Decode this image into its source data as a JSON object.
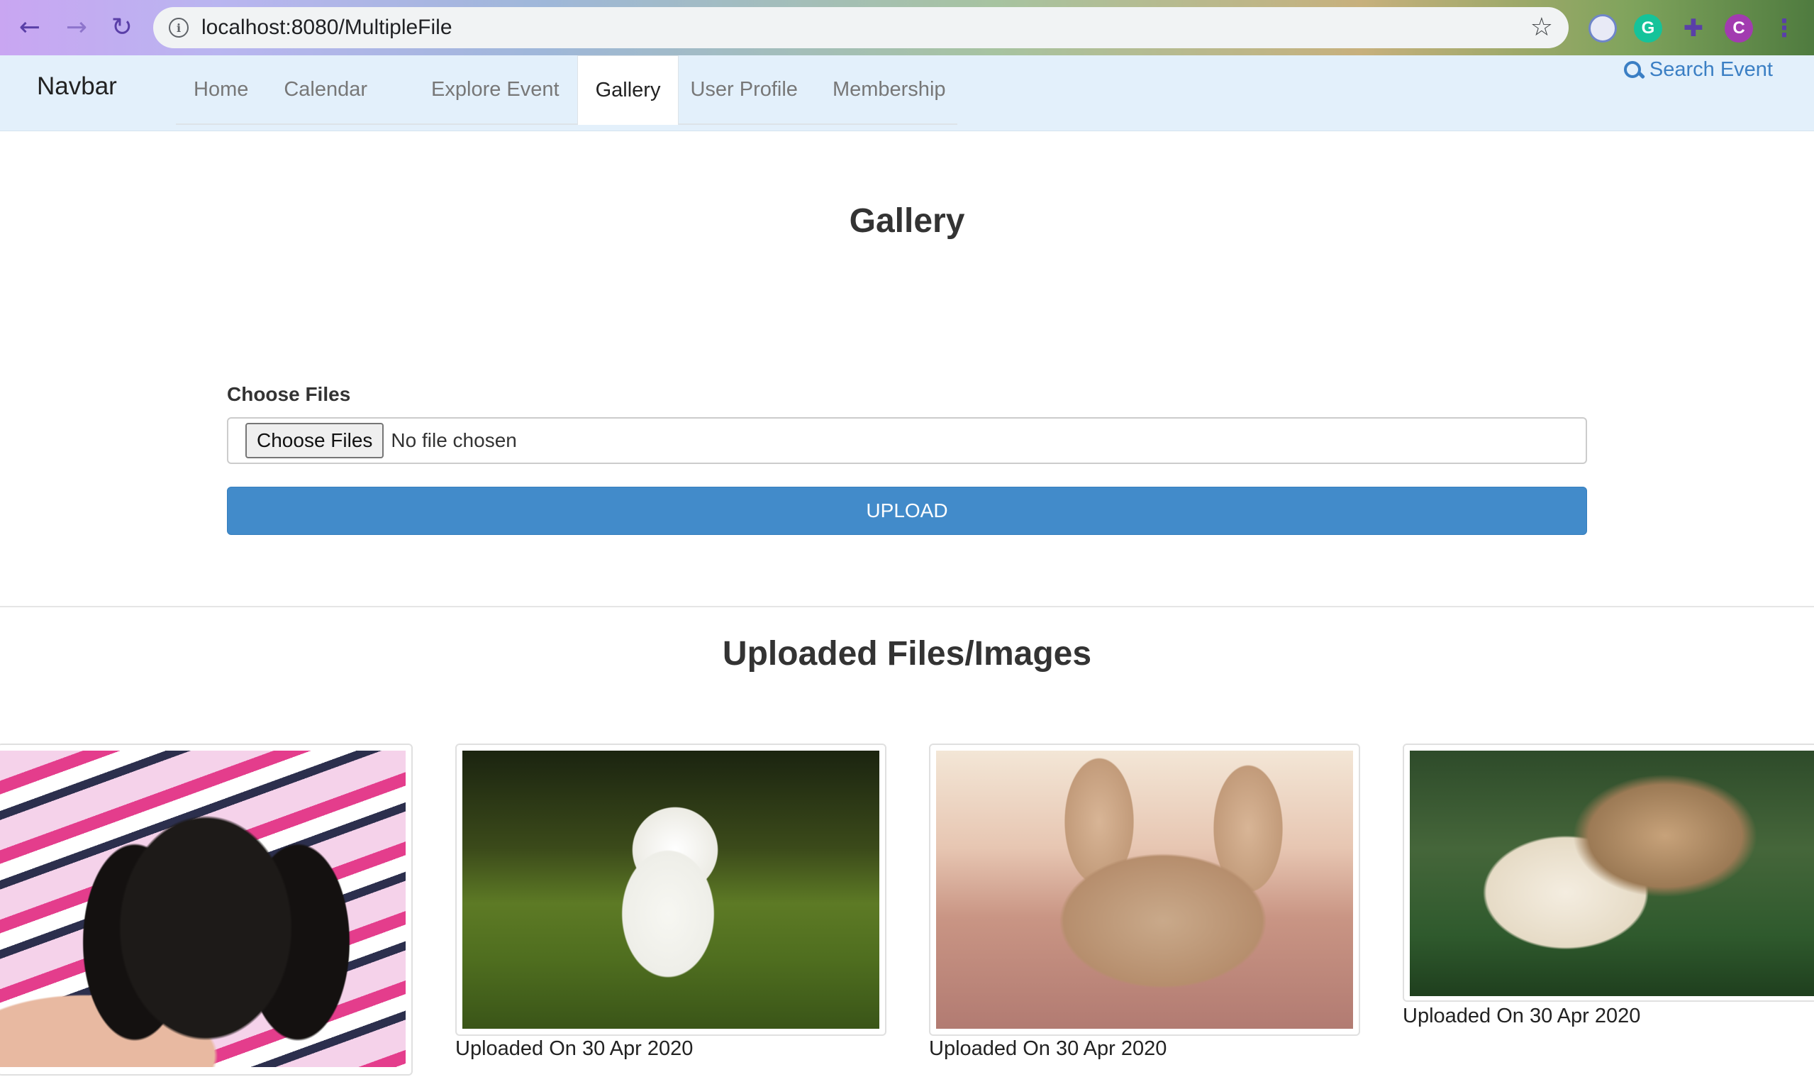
{
  "browser": {
    "url": "localhost:8080/MultipleFile",
    "profile_initial": "C",
    "extension_g": "G"
  },
  "navbar": {
    "brand": "Navbar",
    "tabs": [
      {
        "label": "Home"
      },
      {
        "label": "Calendar"
      },
      {
        "label": "Explore Event"
      },
      {
        "label": "Gallery",
        "active": true
      },
      {
        "label": "User Profile"
      },
      {
        "label": "Membership"
      }
    ],
    "search_label": "Search Event"
  },
  "main": {
    "title": "Gallery",
    "choose_files_label": "Choose Files",
    "file_button_label": "Choose Files",
    "file_status": "No file chosen",
    "upload_label": "UPLOAD",
    "uploaded_heading": "Uploaded Files/Images"
  },
  "gallery": [
    {
      "alt": "Dachshund puppy",
      "caption": ""
    },
    {
      "alt": "White puppy in grass",
      "caption": "Uploaded On 30 Apr 2020"
    },
    {
      "alt": "French bulldog lying down",
      "caption": "Uploaded On 30 Apr 2020"
    },
    {
      "alt": "Kitten and puppy",
      "caption": "Uploaded On 30 Apr 2020"
    }
  ],
  "colors": {
    "accent": "#428bca",
    "navbar_bg": "#e3f0fb",
    "link": "#3b7fc4"
  }
}
